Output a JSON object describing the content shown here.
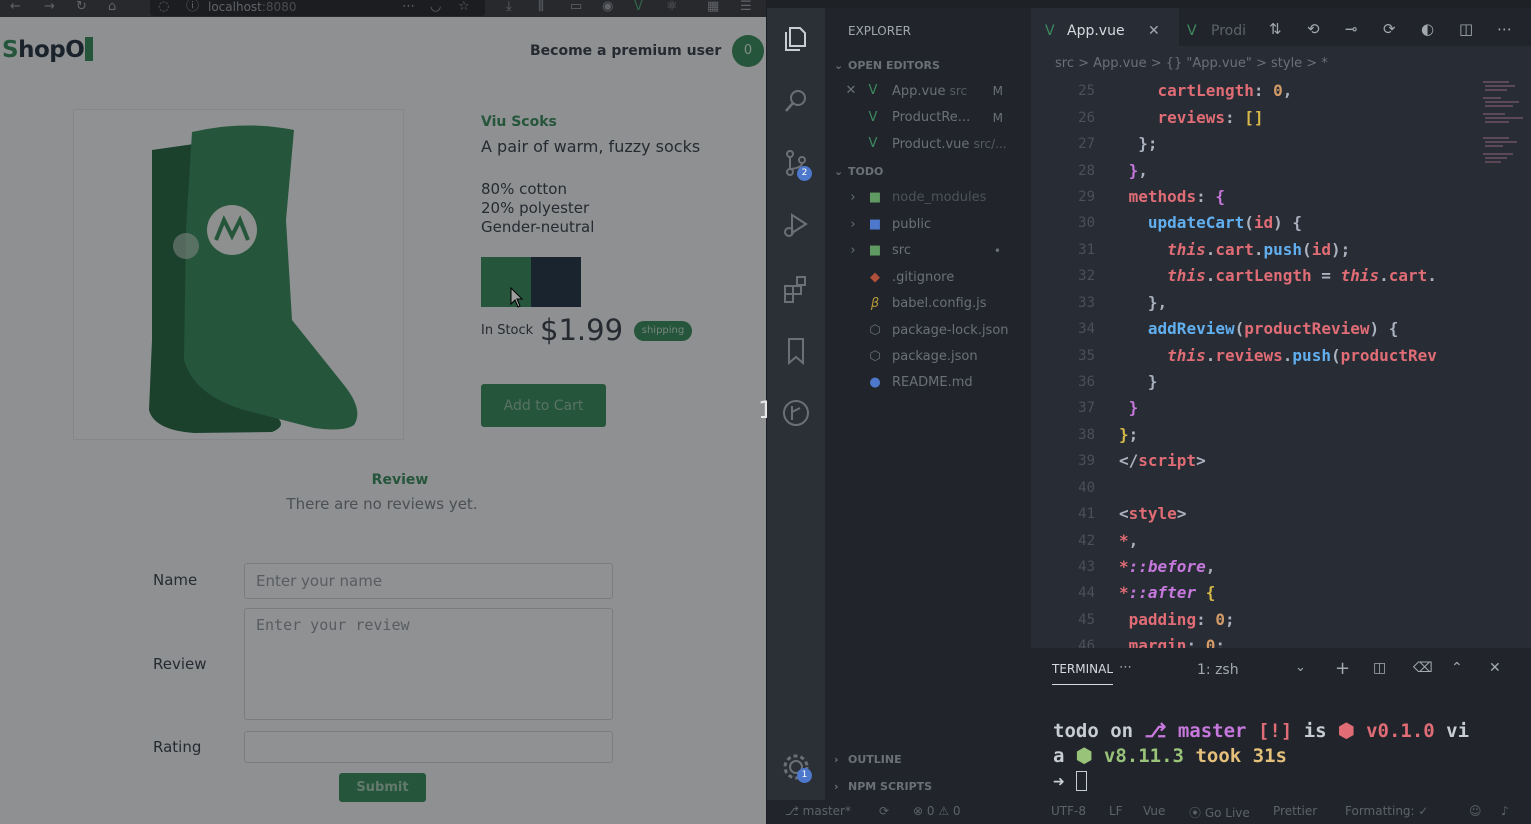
{
  "browser": {
    "url_host": "localhost",
    "url_port": ":8080",
    "brand": {
      "first_letter": "S",
      "rest": "hopO"
    },
    "premium_label": "Become a premium user",
    "cart_count": "0",
    "product": {
      "name": "Viu Scoks",
      "description": "A pair of warm, fuzzy socks",
      "details": [
        "80% cotton",
        "20% polyester",
        "Gender-neutral"
      ],
      "variant_colors": [
        "#3d8a5f",
        "#2b3a4c"
      ],
      "stock": "In Stock",
      "price": "$1.99",
      "shipping_badge": "shipping",
      "add_to_cart": "Add to Cart"
    },
    "reviews": {
      "heading": "Review",
      "empty_text": "There are no reviews yet."
    },
    "form": {
      "name_label": "Name",
      "name_placeholder": "Enter your name",
      "review_label": "Review",
      "review_placeholder": "Enter your review",
      "rating_label": "Rating",
      "submit_label": "Submit"
    }
  },
  "split_marker": "1",
  "vscode": {
    "explorer_title": "EXPLORER",
    "open_editors_title": "OPEN EDITORS",
    "open_editors": [
      {
        "name": "App.vue",
        "path": "src",
        "mark": "M",
        "closable": true
      },
      {
        "name": "ProductRe...",
        "path": "",
        "mark": "M",
        "closable": false
      },
      {
        "name": "Product.vue",
        "path": "src/...",
        "mark": "",
        "closable": false
      }
    ],
    "project_title": "TODO",
    "tree": [
      {
        "name": "node_modules",
        "kind": "folder",
        "mark": ""
      },
      {
        "name": "public",
        "kind": "folder",
        "mark": ""
      },
      {
        "name": "src",
        "kind": "folder",
        "mark": "•"
      },
      {
        "name": ".gitignore",
        "kind": "file",
        "mark": ""
      },
      {
        "name": "babel.config.js",
        "kind": "file",
        "mark": ""
      },
      {
        "name": "package-lock.json",
        "kind": "file",
        "mark": ""
      },
      {
        "name": "package.json",
        "kind": "file",
        "mark": ""
      },
      {
        "name": "README.md",
        "kind": "file",
        "mark": ""
      }
    ],
    "outline_title": "OUTLINE",
    "npm_title": "NPM SCRIPTS",
    "source_control_badge": "2",
    "settings_badge": "1",
    "tabs": {
      "active": "App.vue",
      "inactive": "Prodi"
    },
    "breadcrumb": "src > App.vue > {} \"App.vue\" > style > *",
    "line_numbers": [
      "25",
      "26",
      "27",
      "28",
      "29",
      "30",
      "31",
      "32",
      "33",
      "34",
      "35",
      "36",
      "37",
      "38",
      "39",
      "40",
      "41",
      "42",
      "43",
      "44",
      "45",
      "46"
    ],
    "terminal": {
      "tab_label": "TERMINAL",
      "shell": "1: zsh",
      "line1_a": "todo on ",
      "line1_b": "master ",
      "line1_c": "[!] ",
      "line1_d": "is ",
      "line1_e": "v0.1.0 ",
      "line1_f": "vi",
      "line2_a": "a ",
      "line2_b": "v8.11.3 ",
      "line2_c": "took 31s",
      "prompt": "➜"
    },
    "status": {
      "branch": "master*",
      "problems": "⊗ 0 ⚠ 0",
      "encoding": "UTF-8",
      "eol": "LF",
      "language": "Vue",
      "golive": "Go Live",
      "prettier": "Prettier",
      "formatting": "Formatting: ✓"
    }
  }
}
